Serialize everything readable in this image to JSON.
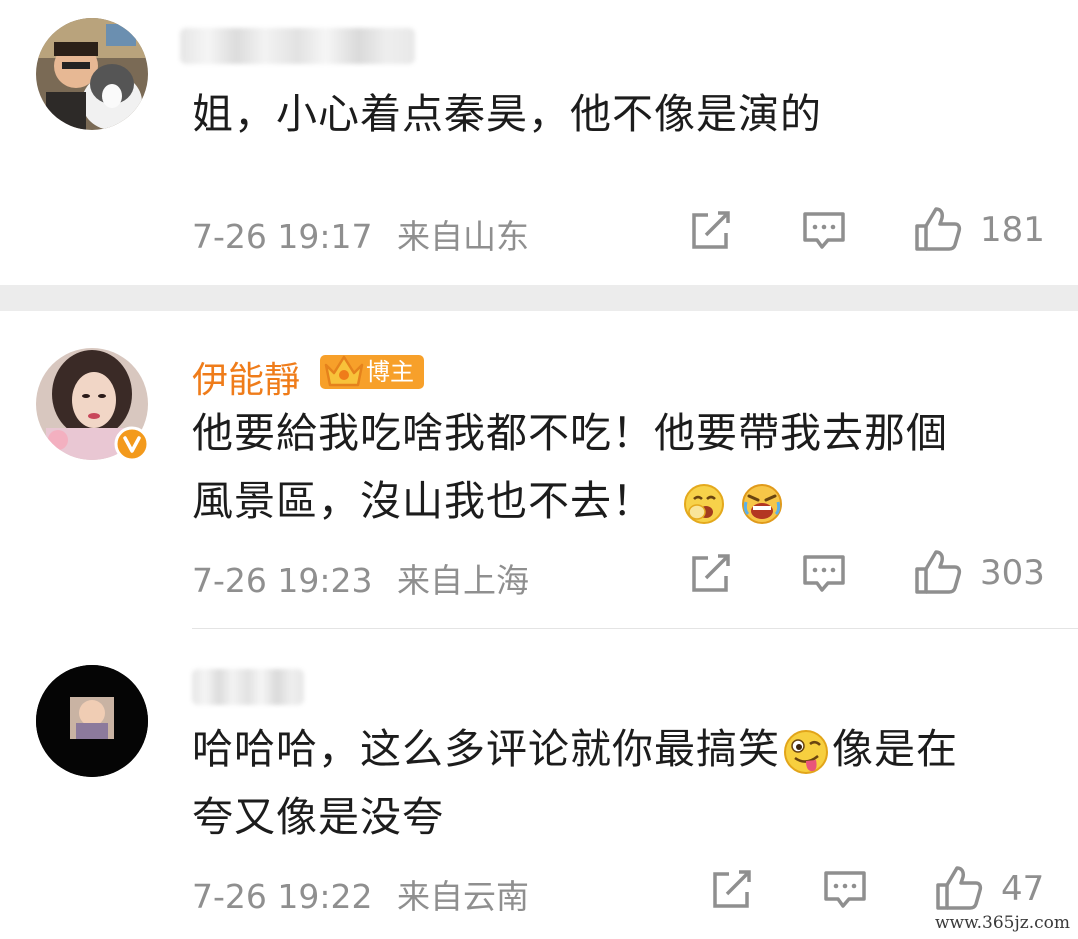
{
  "comments": [
    {
      "username": "",
      "text": "姐，小心着点秦昊，他不像是演的",
      "date": "7-26 19:17",
      "location": "来自山东",
      "likes": "181"
    },
    {
      "username": "伊能靜",
      "badge": "博主",
      "text_line1": "他要給我吃啥我都不吃！他要帶我去那個",
      "text_line2": "風景區，沒山我也不去！",
      "date": "7-26 19:23",
      "location": "来自上海",
      "likes": "303"
    },
    {
      "username": "",
      "text_line1a": "哈哈哈，这么多评论就你最搞笑",
      "text_line1b": "像是在",
      "text_line2": "夸又像是没夸",
      "date": "7-26 19:22",
      "location": "来自云南",
      "likes": "47"
    }
  ],
  "icons": [
    "share-icon",
    "comment-icon",
    "like-icon",
    "verified-icon",
    "crown-icon",
    "yawn-emoji",
    "crying-emoji",
    "tongue-emoji"
  ],
  "watermark": "www.365jz.com",
  "colors": {
    "username": "#ef7c1a",
    "badge": "#f7a02a",
    "meta": "#8f8f8f",
    "verified": "#f39a1c"
  }
}
